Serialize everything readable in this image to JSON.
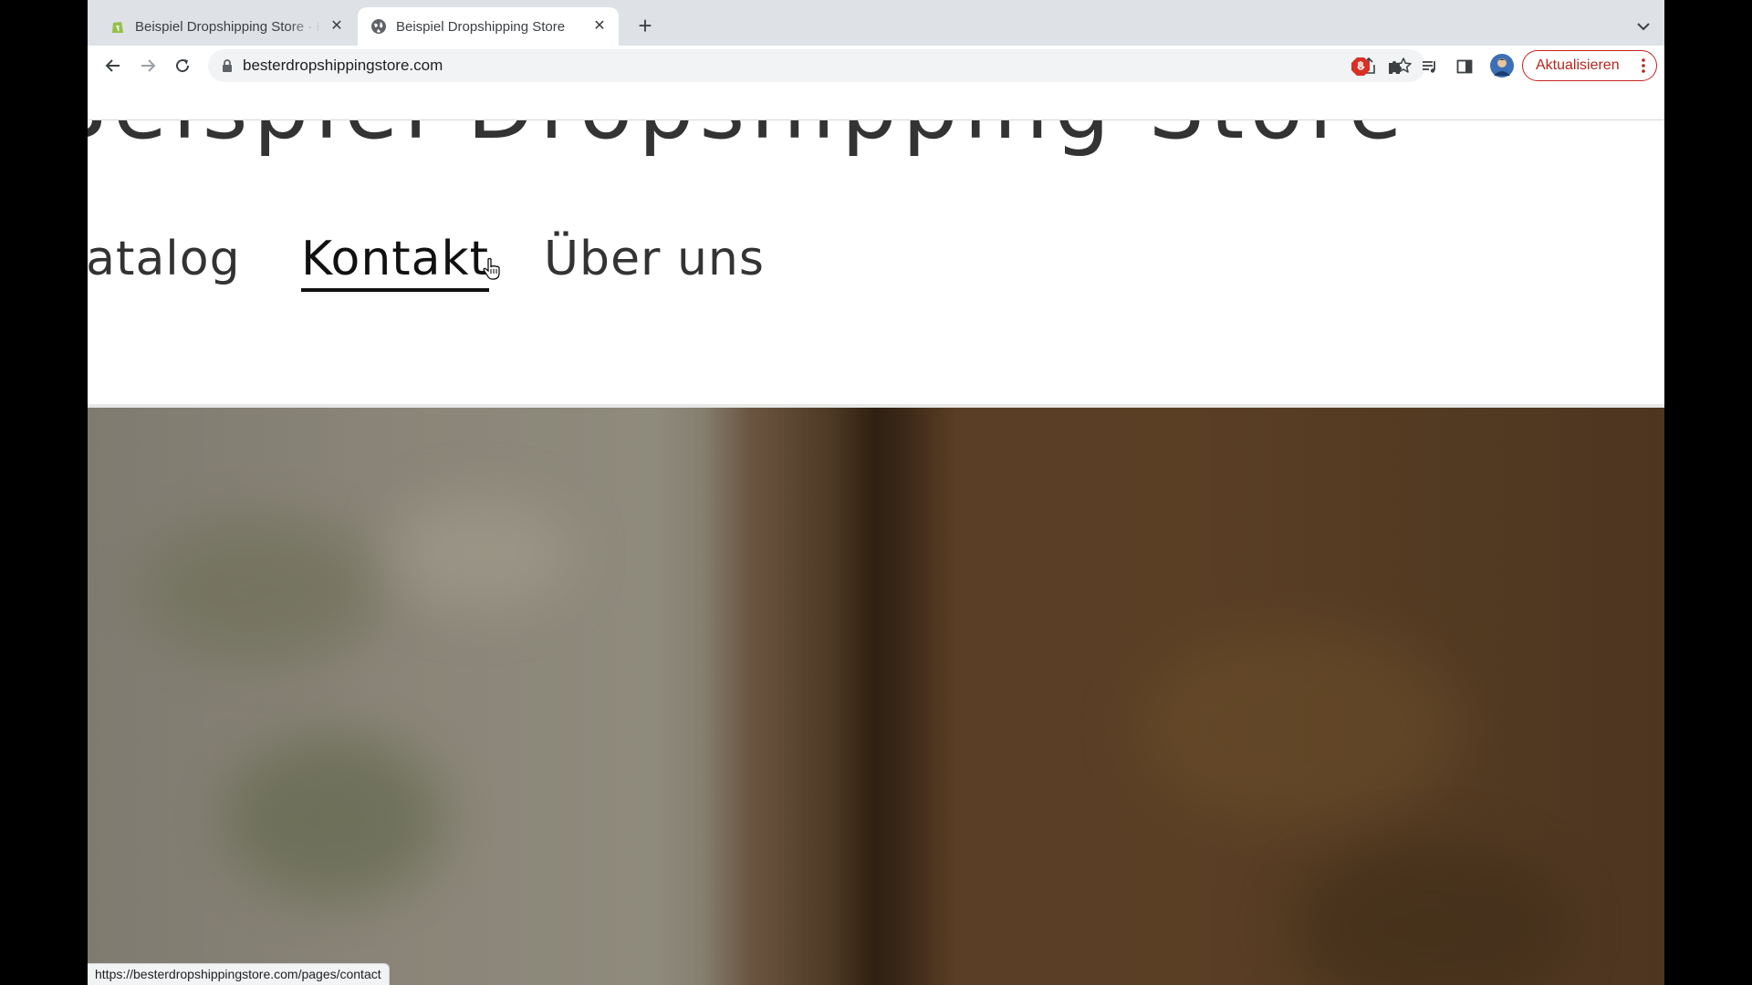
{
  "browser": {
    "tabs": [
      {
        "title": "Beispiel Dropshipping Store · Home · Shopify",
        "active": false,
        "favicon": "shopify-icon"
      },
      {
        "title": "Beispiel Dropshipping Store",
        "active": true,
        "favicon": "globe-icon"
      }
    ],
    "address_bar": {
      "url": "besterdropshippingstore.com"
    },
    "update_button": {
      "label": "Aktualisieren"
    },
    "status_url": "https://besterdropshippingstore.com/pages/contact",
    "colors": {
      "accent_update": "#b3261e",
      "tabstrip": "#dee1e6"
    }
  },
  "page": {
    "store_title": "Beispiel Dropshipping Store",
    "nav": [
      {
        "label": "Katalog",
        "visible_text": "atalog",
        "active": false
      },
      {
        "label": "Kontakt",
        "active": true
      },
      {
        "label": "Über uns",
        "active": false
      }
    ]
  }
}
